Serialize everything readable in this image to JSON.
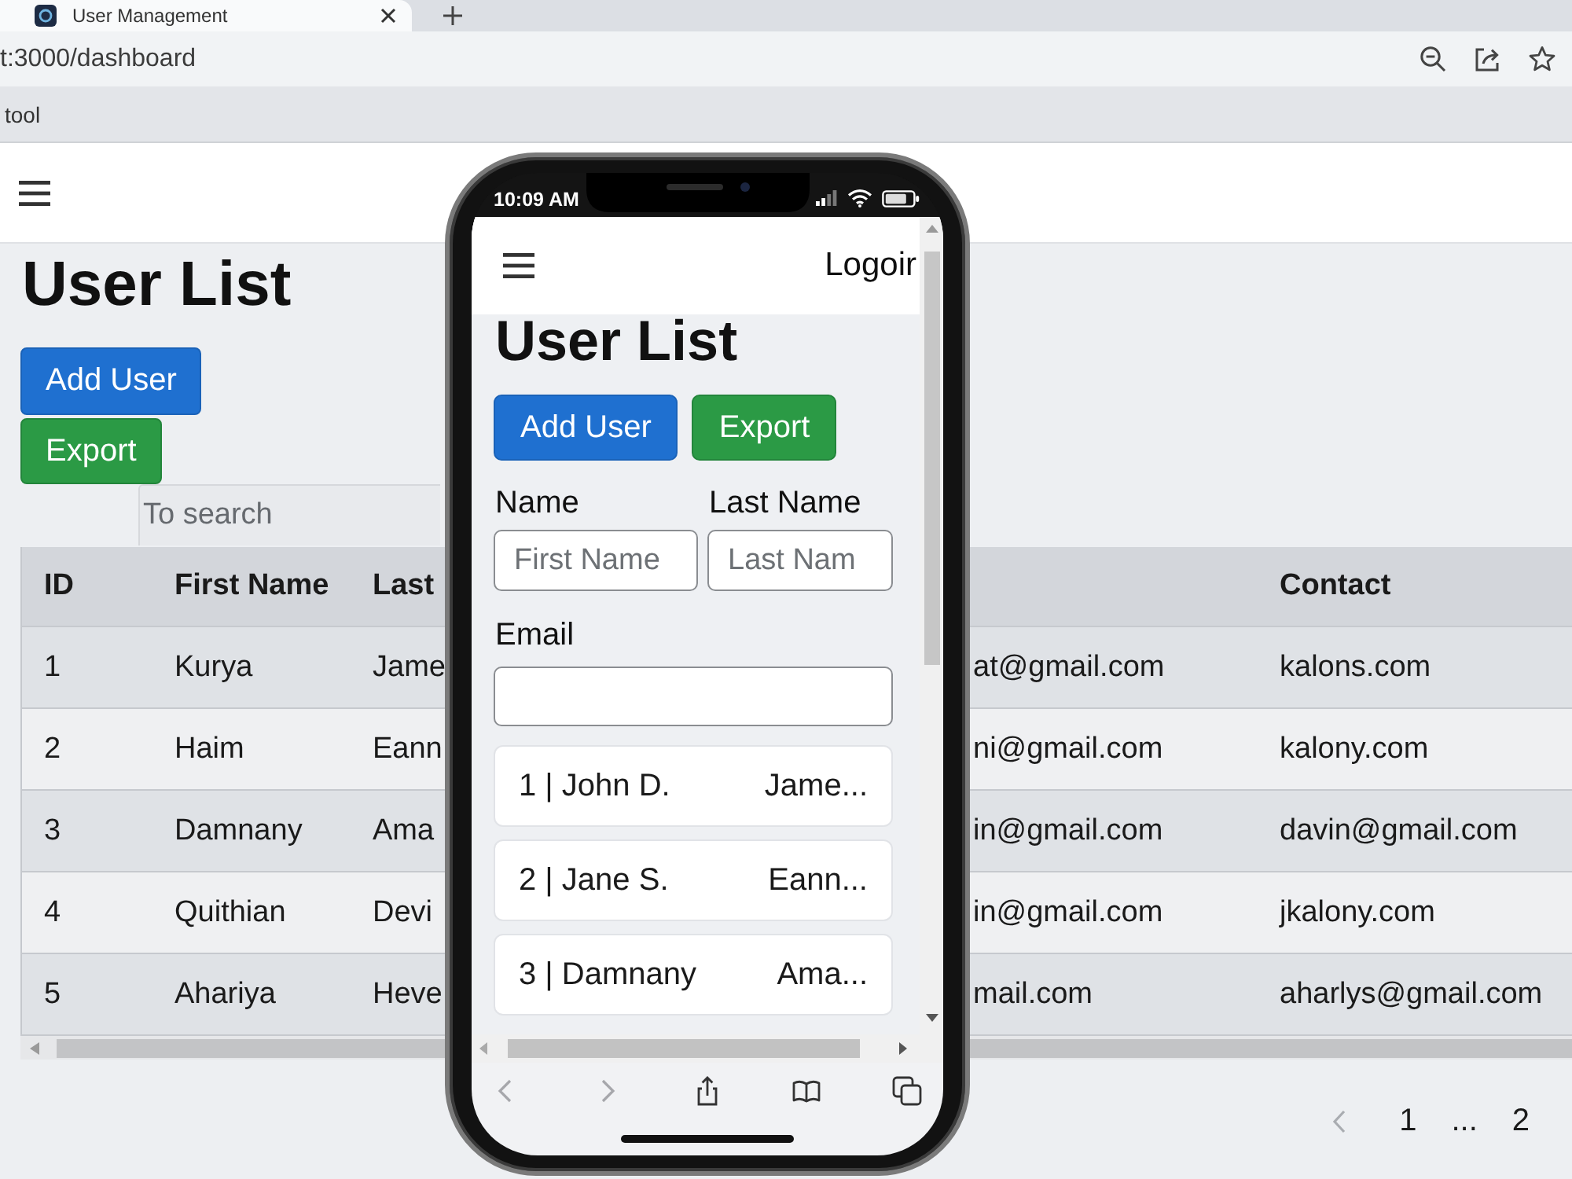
{
  "browser": {
    "tab": {
      "title": "User Management",
      "selected": true
    },
    "address": "t:3000/dashboard",
    "bookmark": "tool"
  },
  "page": {
    "title": "User List",
    "buttons": [
      {
        "label": "Add User",
        "kind": "primary"
      },
      {
        "label": "Export",
        "kind": "success"
      }
    ],
    "search": {
      "placeholder": "To search"
    },
    "table": {
      "columns": [
        "ID",
        "First Name",
        "Last",
        null,
        "Contact"
      ],
      "rows": [
        [
          "1",
          "Kurya",
          "Jame",
          "at@gmail.com",
          "kalons.com"
        ],
        [
          "2",
          "Haim",
          "Eann",
          "ni@gmail.com",
          "kalony.com"
        ],
        [
          "3",
          "Damnany",
          "Ama",
          "in@gmail.com",
          "davin@gmail.com"
        ],
        [
          "4",
          "Quithian",
          "Devi",
          "in@gmail.com",
          "jkalony.com"
        ],
        [
          "5",
          "Ahariya",
          "Heve",
          "mail.com",
          "aharlys@gmail.com"
        ]
      ]
    },
    "pagination": {
      "previous": {
        "disabled": true
      },
      "pages": [
        {
          "label": "1",
          "kind": "page"
        },
        {
          "label": "...",
          "kind": "ellipsis"
        },
        {
          "label": "2",
          "kind": "page"
        }
      ]
    }
  },
  "phone": {
    "time": "10:09 AM",
    "nav_link": "Logoir",
    "title": "User List",
    "buttons": [
      {
        "label": "Add User",
        "kind": "primary"
      },
      {
        "label": "Export",
        "kind": "success"
      }
    ],
    "name_fields": [
      {
        "label": "Name",
        "placeholder": "First Name"
      },
      {
        "label": "Last Name",
        "placeholder": "Last Nam"
      }
    ],
    "email_field": {
      "label": "Email"
    },
    "cards": [
      {
        "title": "1 | John D.",
        "detail": "Jame..."
      },
      {
        "title": "2 | Jane S.",
        "detail": "Eann..."
      },
      {
        "title": "3 | Damnany",
        "detail": "Ama..."
      }
    ],
    "toolbar": {
      "back": {
        "disabled": true
      },
      "forward": {
        "disabled": true
      }
    }
  }
}
